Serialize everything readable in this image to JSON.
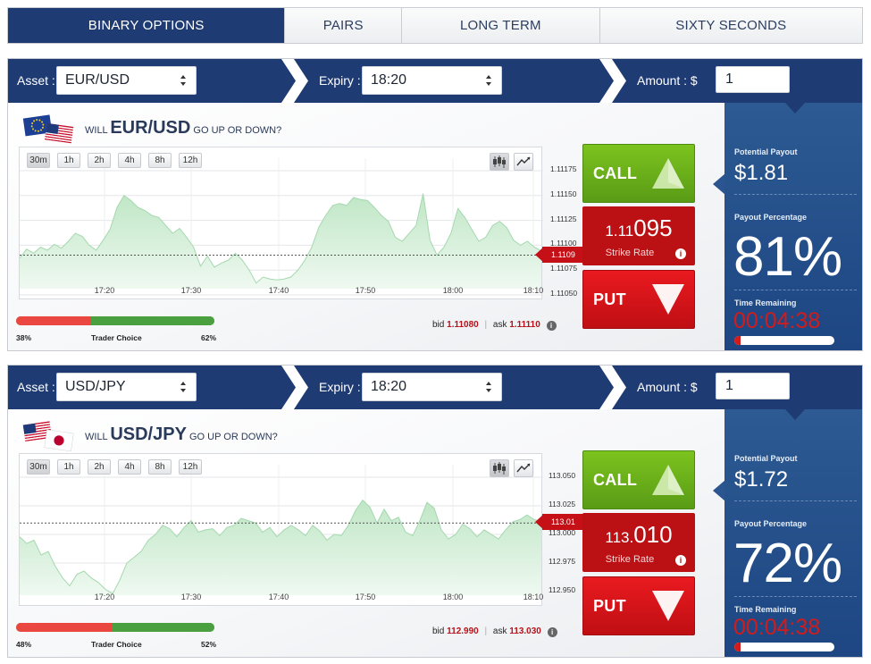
{
  "tabs": [
    {
      "label": "BINARY OPTIONS",
      "active": true
    },
    {
      "label": "PAIRS",
      "active": false
    },
    {
      "label": "LONG TERM",
      "active": false
    },
    {
      "label": "SIXTY SECONDS",
      "active": false
    }
  ],
  "labels": {
    "asset": "Asset :",
    "expiry": "Expiry :",
    "amount": "Amount : $",
    "will": "WILL",
    "go_up": "GO UP OR DOWN?",
    "call": "CALL",
    "put": "PUT",
    "strike_rate": "Strike Rate",
    "trader_choice": "Trader Choice",
    "bid": "bid",
    "ask": "ask",
    "potential_payout": "Potential Payout",
    "payout_percentage": "Payout Percentage",
    "time_remaining": "Time Remaining",
    "info_glyph": "i"
  },
  "timeframes": [
    "30m",
    "1h",
    "2h",
    "4h",
    "8h",
    "12h"
  ],
  "time_labels": [
    "17:20",
    "17:30",
    "17:40",
    "17:50",
    "18:00",
    "18:10"
  ],
  "colors": {
    "navy": "#1f3b73",
    "call_green": "#6fb31a",
    "put_red": "#d8161c",
    "payout_blue": "#2a5590",
    "area_green": "#bfe6c5"
  },
  "panels": [
    {
      "asset": "EUR/USD",
      "expiry": "18:20",
      "amount": "1",
      "flags": [
        "eu-flag-icon",
        "us-flag-icon"
      ],
      "strike_main": "1.11",
      "strike_small": "095",
      "current_price": "1.1109",
      "y_ticks": [
        "1.11175",
        "1.11150",
        "1.11125",
        "1.11100",
        "1.11075",
        "1.11050"
      ],
      "tc_left": "38%",
      "tc_right": "62%",
      "tc_fraction": 0.38,
      "bid": "1.11080",
      "ask": "1.11110",
      "potential_payout": "$1.81",
      "payout_pct": "81%",
      "time_remaining": "00:04:38",
      "time_fraction": 0.06,
      "series": [
        1.11087,
        1.11096,
        1.11092,
        1.11098,
        1.11095,
        1.11101,
        1.11097,
        1.11104,
        1.11112,
        1.11109,
        1.111,
        1.11095,
        1.11105,
        1.11116,
        1.11138,
        1.1115,
        1.11145,
        1.11138,
        1.11135,
        1.1113,
        1.11128,
        1.1112,
        1.11112,
        1.11117,
        1.11108,
        1.11098,
        1.11079,
        1.11089,
        1.11078,
        1.11082,
        1.11085,
        1.11092,
        1.11085,
        1.11075,
        1.11062,
        1.11068,
        1.11066,
        1.11065,
        1.11066,
        1.11068,
        1.11075,
        1.11085,
        1.11098,
        1.11118,
        1.1113,
        1.1114,
        1.11142,
        1.1114,
        1.11148,
        1.11146,
        1.11145,
        1.11138,
        1.1113,
        1.11124,
        1.11108,
        1.11104,
        1.11112,
        1.1112,
        1.11152,
        1.11105,
        1.1109,
        1.11098,
        1.11112,
        1.11137,
        1.11128,
        1.11116,
        1.11104,
        1.11108,
        1.1112,
        1.11124,
        1.11118,
        1.11105,
        1.111,
        1.11104,
        1.11098,
        1.11094
      ]
    },
    {
      "asset": "USD/JPY",
      "expiry": "18:20",
      "amount": "1",
      "flags": [
        "us-flag-icon",
        "jp-flag-icon"
      ],
      "strike_main": "113.",
      "strike_small": "010",
      "current_price": "113.01",
      "y_ticks": [
        "113.050",
        "113.025",
        "113.000",
        "112.975",
        "112.950"
      ],
      "tc_left": "48%",
      "tc_right": "52%",
      "tc_fraction": 0.48,
      "bid": "112.990",
      "ask": "113.030",
      "potential_payout": "$1.72",
      "payout_pct": "72%",
      "time_remaining": "00:04:38",
      "time_fraction": 0.06,
      "series": [
        112.998,
        112.992,
        112.995,
        112.982,
        112.985,
        112.972,
        112.962,
        112.955,
        112.965,
        112.968,
        112.962,
        112.958,
        112.952,
        112.948,
        112.96,
        112.975,
        112.98,
        112.985,
        112.995,
        113.0,
        113.008,
        113.005,
        112.998,
        113.006,
        113.012,
        113.002,
        113.004,
        113.005,
        112.999,
        113.006,
        113.008,
        113.014,
        113.012,
        113.01,
        113.002,
        113.006,
        112.998,
        113.004,
        113.008,
        113.004,
        112.999,
        113.008,
        113.003,
        112.995,
        113.0,
        112.999,
        113.008,
        113.021,
        113.03,
        113.024,
        113.01,
        113.022,
        113.012,
        113.015,
        113.002,
        112.999,
        113.012,
        113.028,
        113.023,
        113.004,
        112.996,
        113.0,
        113.009,
        113.005,
        112.998,
        113.004,
        113.0,
        112.996,
        113.004,
        113.011,
        113.013,
        113.017,
        113.013,
        113.011
      ]
    }
  ]
}
